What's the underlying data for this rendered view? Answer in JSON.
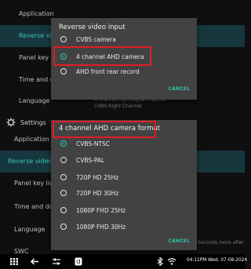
{
  "background": {
    "items": [
      {
        "label": "Application"
      },
      {
        "label": "Reverse video"
      },
      {
        "label": "Panel key light"
      },
      {
        "label": "Time and date"
      },
      {
        "label": "Language"
      }
    ],
    "settings_title": "Settings",
    "items_lower": [
      {
        "label": "Application"
      },
      {
        "label": "Reverse video"
      },
      {
        "label": "Panel key light"
      },
      {
        "label": "Time and date"
      },
      {
        "label": "Language"
      },
      {
        "label": "SWC"
      }
    ],
    "right_text_1": "4 channel right digital channel",
    "right_text_2": "CVBS-Right Channel",
    "right_text_3": "Seconds more after"
  },
  "dialog_input": {
    "title": "Reverse video input",
    "options": [
      {
        "label": "CVBS camera",
        "selected": false
      },
      {
        "label": "4 channel AHD camera",
        "selected": true
      },
      {
        "label": "AHD front rear record",
        "selected": false
      }
    ],
    "cancel": "CANCEL"
  },
  "dialog_format": {
    "title": "4 channel AHD camera format",
    "options": [
      {
        "label": "CVBS-NTSC",
        "selected": true
      },
      {
        "label": "CVBS-PAL",
        "selected": false
      },
      {
        "label": "720P HD 25Hz",
        "selected": false
      },
      {
        "label": "720P HD 30Hz",
        "selected": false
      },
      {
        "label": "1080P FHD 25Hz",
        "selected": false
      },
      {
        "label": "1080P FHD 30Hz",
        "selected": false
      }
    ],
    "cancel": "CANCEL"
  },
  "statusbar": {
    "time_date": "04:11PM Wed. 07-08-2024"
  },
  "colors": {
    "accent": "#35c1b0",
    "highlight": "#e11d24",
    "dialog_bg": "#424242"
  }
}
